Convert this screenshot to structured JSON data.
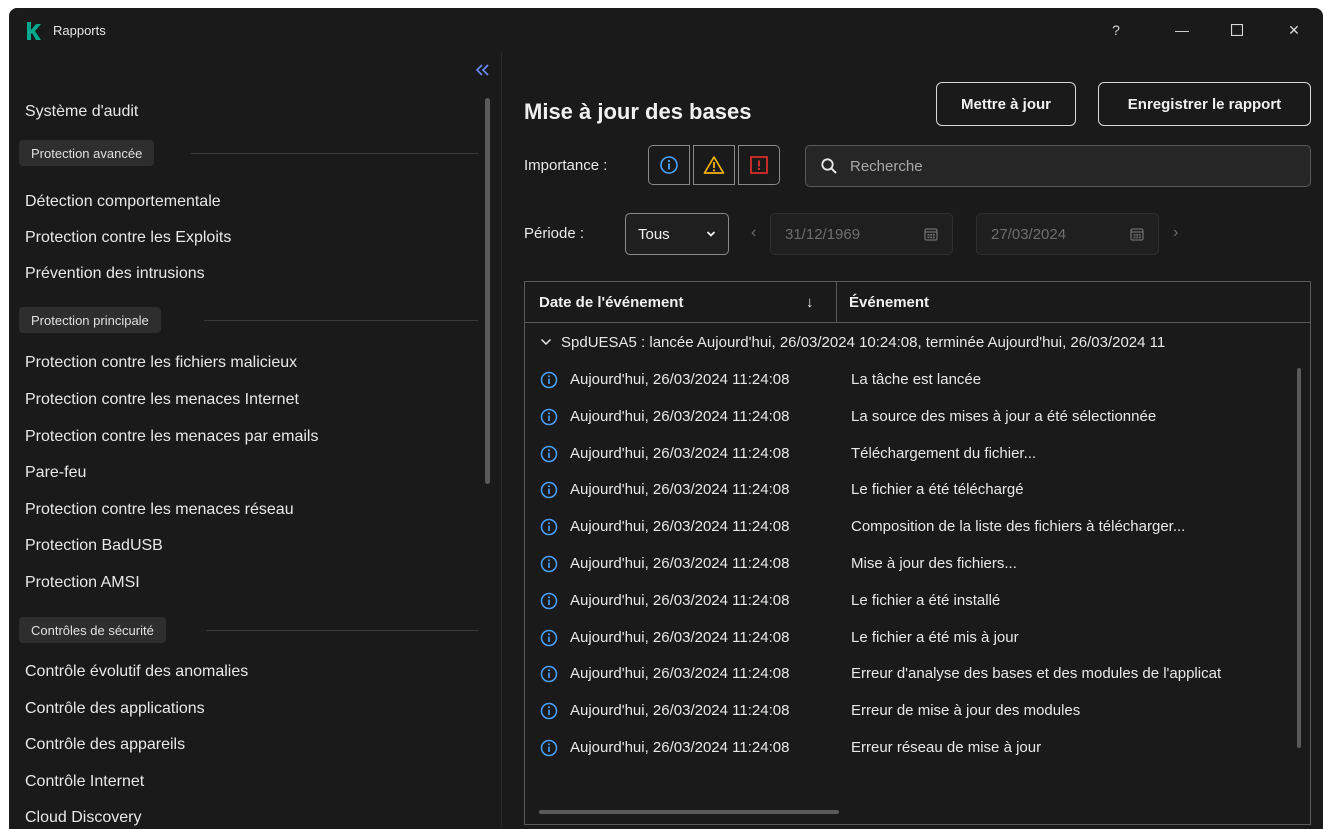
{
  "window": {
    "title": "Rapports",
    "help_label": "?",
    "minimize_label": "—",
    "close_label": "✕"
  },
  "sidebar": {
    "top_item": "Système d'audit",
    "sections": [
      {
        "title": "Protection avancée",
        "items": [
          "Détection comportementale",
          "Protection contre les Exploits",
          "Prévention des intrusions"
        ]
      },
      {
        "title": "Protection principale",
        "items": [
          "Protection contre les fichiers malicieux",
          "Protection contre les menaces Internet",
          "Protection contre les menaces par emails",
          "Pare-feu",
          "Protection contre les menaces réseau",
          "Protection BadUSB",
          "Protection AMSI"
        ]
      },
      {
        "title": "Contrôles de sécurité",
        "items": [
          "Contrôle évolutif des anomalies",
          "Contrôle des applications",
          "Contrôle des appareils",
          "Contrôle Internet",
          "Cloud Discovery"
        ]
      }
    ]
  },
  "main": {
    "title": "Mise à jour des bases",
    "update_button": "Mettre à jour",
    "save_button": "Enregistrer le rapport",
    "importance_label": "Importance :",
    "search_placeholder": "Recherche",
    "period_label": "Période :",
    "period_value": "Tous",
    "date_from": "31/12/1969",
    "date_to": "27/03/2024"
  },
  "table": {
    "col_date": "Date de l'événement",
    "col_event": "Événement",
    "sort_indicator": "↓",
    "group_label": "SpdUESA5 : lancée Aujourd'hui, 26/03/2024 10:24:08, terminée Aujourd'hui, 26/03/2024 11",
    "rows": [
      {
        "date": "Aujourd'hui, 26/03/2024 11:24:08",
        "event": "La tâche est lancée"
      },
      {
        "date": "Aujourd'hui, 26/03/2024 11:24:08",
        "event": "La source des mises à jour a été sélectionnée"
      },
      {
        "date": "Aujourd'hui, 26/03/2024 11:24:08",
        "event": "Téléchargement du fichier..."
      },
      {
        "date": "Aujourd'hui, 26/03/2024 11:24:08",
        "event": "Le fichier a été téléchargé"
      },
      {
        "date": "Aujourd'hui, 26/03/2024 11:24:08",
        "event": "Composition de la liste des fichiers à télécharger..."
      },
      {
        "date": "Aujourd'hui, 26/03/2024 11:24:08",
        "event": "Mise à jour des fichiers..."
      },
      {
        "date": "Aujourd'hui, 26/03/2024 11:24:08",
        "event": "Le fichier a été installé"
      },
      {
        "date": "Aujourd'hui, 26/03/2024 11:24:08",
        "event": "Le fichier a été mis à jour"
      },
      {
        "date": "Aujourd'hui, 26/03/2024 11:24:08",
        "event": "Erreur d'analyse des bases et des modules de l'applicat"
      },
      {
        "date": "Aujourd'hui, 26/03/2024 11:24:08",
        "event": "Erreur de mise à jour des modules"
      },
      {
        "date": "Aujourd'hui, 26/03/2024 11:24:08",
        "event": "Erreur réseau de mise à jour"
      }
    ]
  },
  "colors": {
    "background": "#1a1a1a",
    "brand": "#00a88e",
    "warning": "#f5b400",
    "critical": "#e0302a"
  }
}
